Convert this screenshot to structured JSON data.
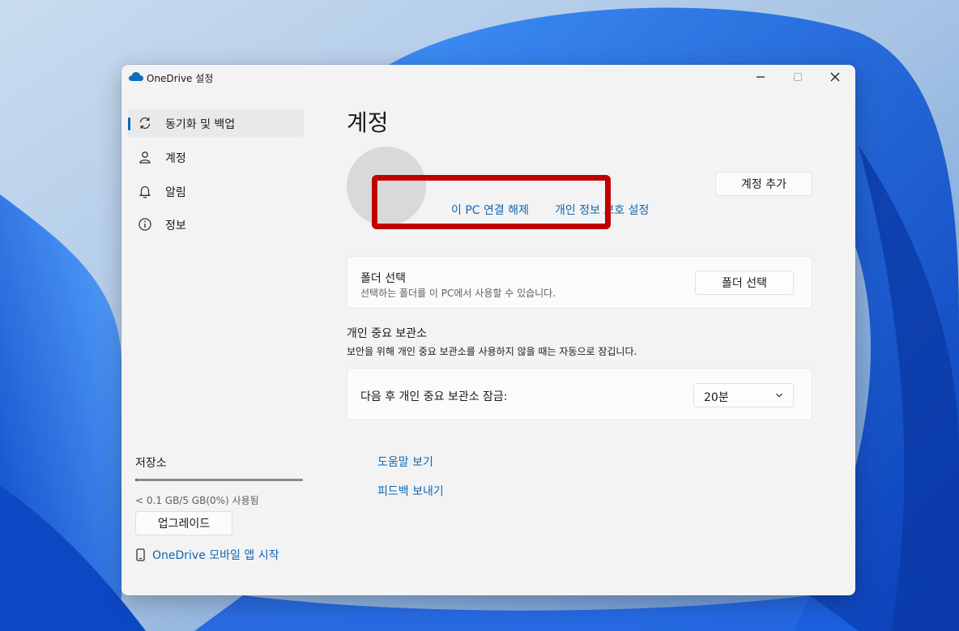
{
  "window": {
    "title": "OneDrive 설정"
  },
  "sidebar": {
    "items": [
      {
        "label": "동기화 및 백업",
        "icon": "sync-icon",
        "selected": true
      },
      {
        "label": "계정",
        "icon": "person-icon",
        "selected": false
      },
      {
        "label": "알림",
        "icon": "bell-icon",
        "selected": false
      },
      {
        "label": "정보",
        "icon": "info-icon",
        "selected": false
      }
    ],
    "storage": {
      "title": "저장소",
      "usage_text": "< 0.1 GB/5 GB(0%) 사용됨",
      "used_fraction": 0.0,
      "upgrade_label": "업그레이드",
      "mobile_app_label": "OneDrive 모바일 앱 시작"
    }
  },
  "main": {
    "title": "계정",
    "account": {
      "unlink_label": "이 PC 연결 해제",
      "privacy_label": "개인 정보 보호 설정",
      "add_account_label": "계정 추가"
    },
    "folder_section": {
      "title": "폴더 선택",
      "description": "선택하는 폴더를 이 PC에서 사용할 수 있습니다.",
      "button_label": "폴더 선택"
    },
    "vault": {
      "heading": "개인 중요 보관소",
      "description": "보안을 위해 개인 중요 보관소를 사용하지 않을 때는 자동으로 잠깁니다.",
      "lock_label": "다음 후 개인 중요 보관소 잠금:",
      "lock_value": "20분"
    },
    "links": {
      "help": "도움말 보기",
      "feedback": "피드백 보내기"
    }
  },
  "colors": {
    "accent": "#1167b1",
    "highlight": "#c00000"
  }
}
